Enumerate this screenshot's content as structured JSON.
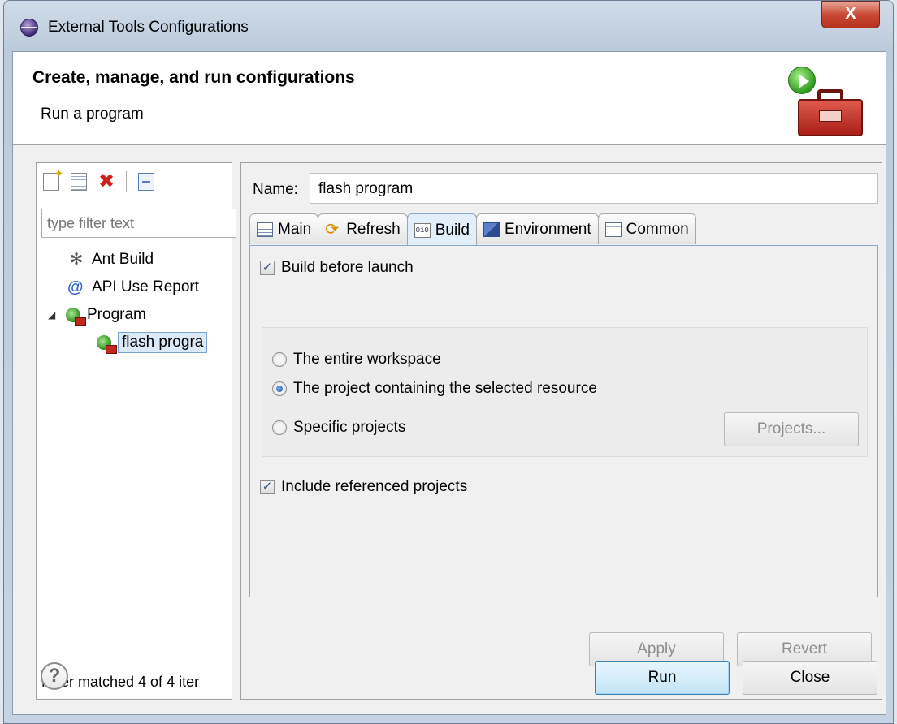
{
  "window": {
    "title": "External Tools Configurations",
    "close_glyph": "X"
  },
  "banner": {
    "title": "Create, manage, and run configurations",
    "subtitle": "Run a program"
  },
  "left": {
    "toolbar_icons": [
      "new-config-icon",
      "duplicate-icon",
      "delete-icon",
      "collapse-all-icon"
    ],
    "filter_placeholder": "type filter text",
    "tree": [
      {
        "label": "Ant Build",
        "icon": "ant-icon"
      },
      {
        "label": "API Use Report",
        "icon": "api-report-icon"
      },
      {
        "label": "Program",
        "icon": "program-icon",
        "expanded": true
      },
      {
        "label": "flash progra",
        "icon": "program-icon",
        "selected": true
      }
    ],
    "status": "Filter matched 4 of 4 iter"
  },
  "right": {
    "name_label": "Name:",
    "name_value": "flash program",
    "tabs": [
      {
        "label": "Main",
        "icon": "main-tab-icon"
      },
      {
        "label": "Refresh",
        "icon": "refresh-icon"
      },
      {
        "label": "Build",
        "icon": "build-icon",
        "active": true
      },
      {
        "label": "Environment",
        "icon": "environment-icon"
      },
      {
        "label": "Common",
        "icon": "common-icon"
      }
    ],
    "build_before_launch": "Build before launch",
    "build_before_launch_checked": true,
    "radio_options": [
      {
        "label": "The entire workspace",
        "checked": false
      },
      {
        "label": "The project containing the selected resource",
        "checked": true
      },
      {
        "label": "Specific projects",
        "checked": false
      }
    ],
    "projects_button": "Projects...",
    "include_referenced": "Include referenced projects",
    "include_referenced_checked": true,
    "apply_button": "Apply",
    "revert_button": "Revert"
  },
  "footer": {
    "run_button": "Run",
    "close_button": "Close",
    "help_glyph": "?"
  },
  "colors": {
    "title_bar": "#c6d3e2",
    "close_button": "#c84a35",
    "selection": "#dbe9f9",
    "default_button": "#c2e4f6"
  }
}
